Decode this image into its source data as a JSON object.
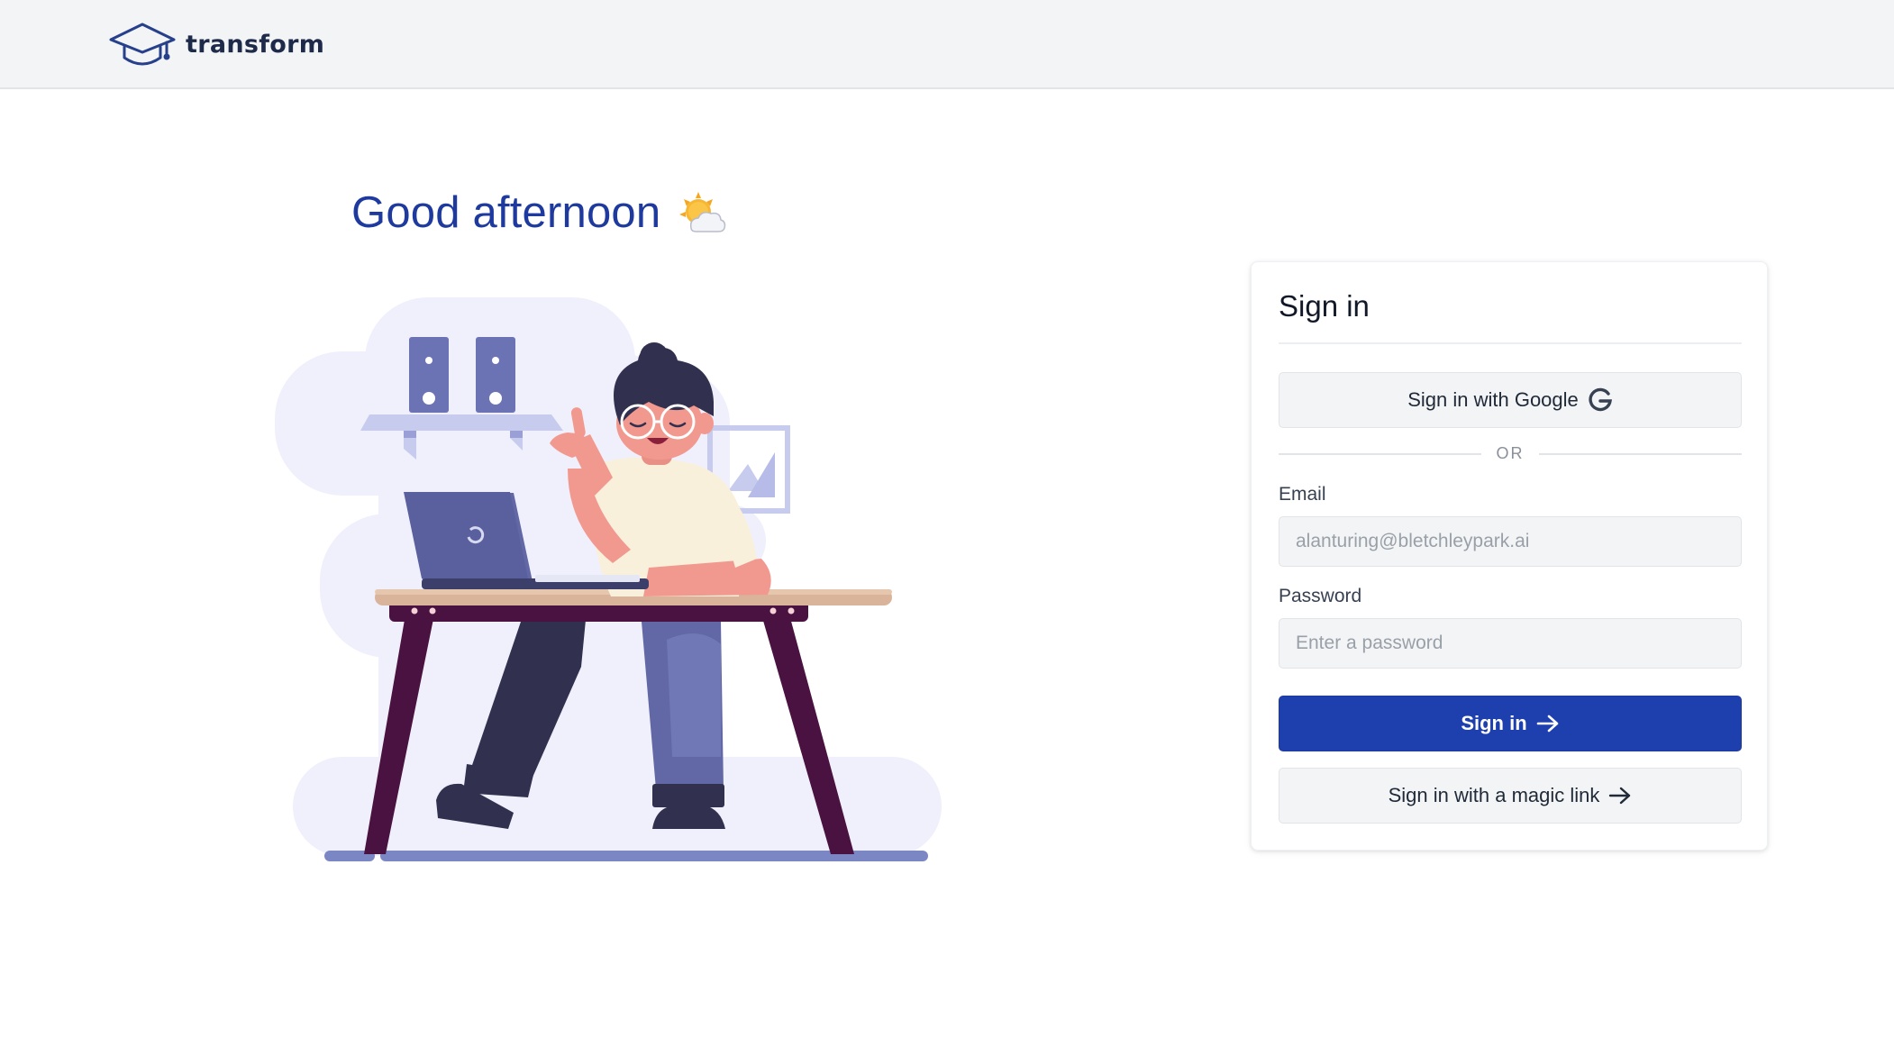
{
  "header": {
    "app_name": "transform"
  },
  "greeting": {
    "text": "Good afternoon",
    "icon": "sun-behind-cloud-icon"
  },
  "illustration": {
    "icon": "person-at-desk-illustration"
  },
  "signin": {
    "title": "Sign in",
    "google_button_label": "Sign in with Google",
    "divider_text": "OR",
    "email": {
      "label": "Email",
      "value": "",
      "placeholder": "alanturing@bletchleypark.ai"
    },
    "password": {
      "label": "Password",
      "value": "",
      "placeholder": "Enter a password"
    },
    "submit_label": "Sign in",
    "magic_link_label": "Sign in with a magic link"
  },
  "colors": {
    "brand_primary": "#1e40af",
    "greeting_blue": "#1e3a9e",
    "header_bg": "#f3f4f6",
    "illustration_bg": "#eff0fb"
  }
}
